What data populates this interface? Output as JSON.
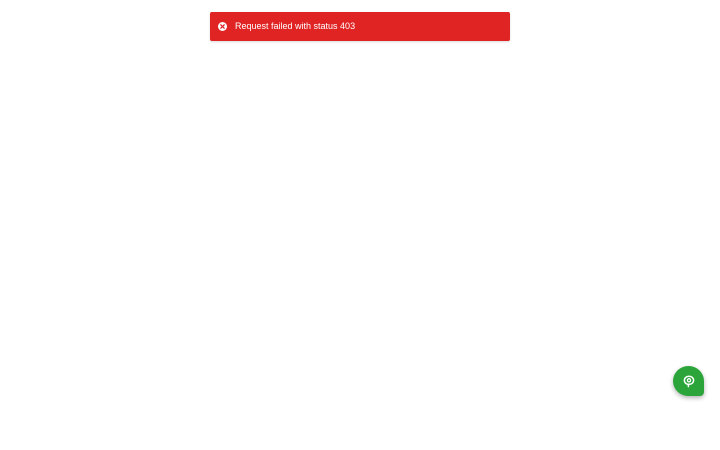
{
  "toast": {
    "type": "error",
    "message": "Request failed with status 403",
    "icon": "error-circle-x-icon",
    "color": "#e02424"
  },
  "chat_launcher": {
    "icon": "chat-bubble-icon",
    "color": "#2ba53a"
  }
}
